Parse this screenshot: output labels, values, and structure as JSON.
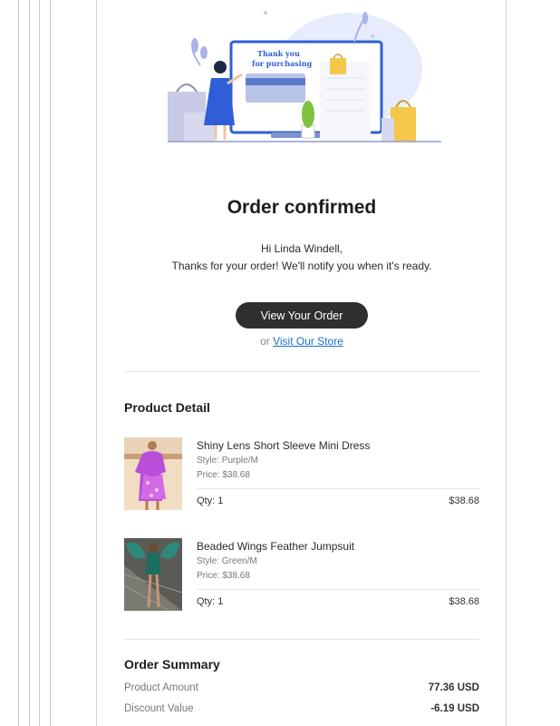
{
  "email": {
    "title": "Order confirmed",
    "greeting": "Hi Linda Windell,",
    "message": "Thanks for your order! We'll notify you when it's ready.",
    "illustration_caption": [
      "Thank you",
      "for purchasing"
    ],
    "cta_label": "View Your Order",
    "or_text": "or",
    "store_link": "Visit Our Store"
  },
  "product_detail": {
    "heading": "Product Detail",
    "items": [
      {
        "name": "Shiny Lens Short Sleeve Mini Dress",
        "style": "Style: Purple/M",
        "price": "Price: $38.68",
        "qty": "Qty: 1",
        "total": "$38.68"
      },
      {
        "name": "Beaded Wings Feather Jumpsuit",
        "style": "Style: Green/M",
        "price": "Price: $38.68",
        "qty": "Qty: 1",
        "total": "$38.68"
      }
    ]
  },
  "order_summary": {
    "heading": "Order Summary",
    "rows": [
      {
        "label": "Product Amount",
        "value": "77.36 USD"
      },
      {
        "label": "Discount Value",
        "value": "-6.19 USD"
      }
    ]
  },
  "colors": {
    "button_bg": "#2f2f2f",
    "link": "#1a6fd1",
    "illustration_blue": "#2f5fd6",
    "bag_yellow": "#f5c84c"
  }
}
